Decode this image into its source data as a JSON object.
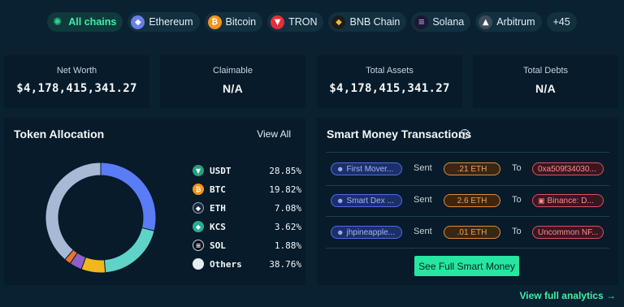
{
  "chains": [
    {
      "label": "All chains",
      "icon": "all-chains-icon",
      "color": "#2fd48f"
    },
    {
      "label": "Ethereum",
      "icon": "ethereum-icon",
      "color": "#6a7fe8"
    },
    {
      "label": "Bitcoin",
      "icon": "bitcoin-icon",
      "color": "#f7931a"
    },
    {
      "label": "TRON",
      "icon": "tron-icon",
      "color": "#e5303a"
    },
    {
      "label": "BNB Chain",
      "icon": "bnb-icon",
      "color": "#f3ba2f"
    },
    {
      "label": "Solana",
      "icon": "solana-icon",
      "color": "#1a1a2e"
    },
    {
      "label": "Arbitrum",
      "icon": "arbitrum-icon",
      "color": "#3c4a5c"
    }
  ],
  "more_chains": "+45",
  "stats": {
    "net_worth": {
      "label": "Net Worth",
      "value": "$4,178,415,341.27"
    },
    "claimable": {
      "label": "Claimable",
      "value": "N/A"
    },
    "total_assets": {
      "label": "Total Assets",
      "value": "$4,178,415,341.27"
    },
    "total_debts": {
      "label": "Total Debts",
      "value": "N/A"
    }
  },
  "allocation": {
    "title": "Token Allocation",
    "view_all": "View All",
    "tokens": [
      {
        "symbol": "USDT",
        "percent": "28.85%",
        "value": 28.85,
        "color": "#5b7cf7",
        "icon": "usdt-icon"
      },
      {
        "symbol": "BTC",
        "percent": "19.82%",
        "value": 19.82,
        "color": "#5fd3c8",
        "icon": "btc-icon"
      },
      {
        "symbol": "ETH",
        "percent": "7.08%",
        "value": 7.08,
        "color": "#f0b81c",
        "icon": "eth-icon"
      },
      {
        "symbol": "KCS",
        "percent": "3.62%",
        "value": 3.62,
        "color": "#8e5fc7",
        "icon": "kcs-icon"
      },
      {
        "symbol": "SOL",
        "percent": "1.88%",
        "value": 1.88,
        "color": "#e9742e",
        "icon": "sol-icon"
      },
      {
        "symbol": "Others",
        "percent": "38.76%",
        "value": 38.76,
        "color": "#a8b9d6",
        "icon": "others-icon"
      }
    ]
  },
  "smart_money": {
    "title": "Smart Money Transactions",
    "sent_word": "Sent",
    "to_word": "To",
    "transactions": [
      {
        "from": "First Mover...",
        "amount": ".21 ETH",
        "to": "0xa509f34030..."
      },
      {
        "from": "Smart Dex ...",
        "amount": "2.6 ETH",
        "to": "Binance: D..."
      },
      {
        "from": "jhpineapple...",
        "amount": ".01 ETH",
        "to": "Uncommon NF..."
      }
    ],
    "cta": "See Full Smart Money"
  },
  "footer_link": "View full analytics →"
}
